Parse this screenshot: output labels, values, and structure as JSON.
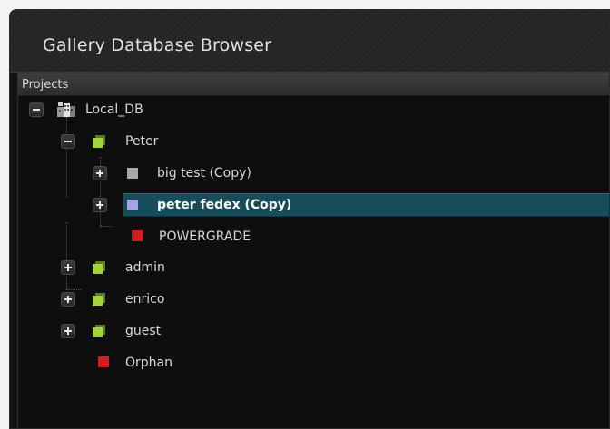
{
  "window": {
    "title": "Gallery Database Browser"
  },
  "panel": {
    "header": "Projects"
  },
  "tree": {
    "root": {
      "label": "Local_DB",
      "icon": "database-icon",
      "expanded": true
    },
    "peter": {
      "label": "Peter",
      "icon": "user-folder-icon",
      "expanded": true
    },
    "big_test": {
      "label": "big test (Copy)",
      "icon": "project-grey-icon",
      "expanded": false
    },
    "peter_fedex": {
      "label": "peter fedex (Copy)",
      "icon": "project-lilac-icon",
      "expanded": false,
      "selected": true
    },
    "powergrade": {
      "label": "POWERGRADE",
      "icon": "powergrade-red-icon"
    },
    "admin": {
      "label": "admin",
      "icon": "user-folder-icon",
      "expanded": false
    },
    "enrico": {
      "label": "enrico",
      "icon": "user-folder-icon",
      "expanded": false
    },
    "guest": {
      "label": "guest",
      "icon": "user-folder-icon",
      "expanded": false
    },
    "orphan": {
      "label": "Orphan",
      "icon": "orphan-red-icon"
    }
  },
  "colors": {
    "selection": "#174d5a",
    "user_folder": "#a3d33a",
    "project_grey": "#a9a9a9",
    "project_lilac": "#a7a3e4",
    "red_item": "#d21e1e"
  }
}
